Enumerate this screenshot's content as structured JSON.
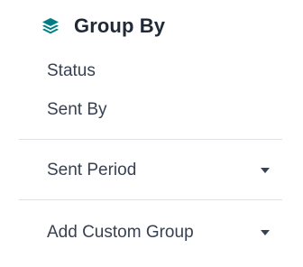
{
  "group_by": {
    "title": "Group By",
    "icon": "layers-icon",
    "accent_color": "#017e84",
    "options": [
      {
        "label": "Status"
      },
      {
        "label": "Sent By"
      }
    ],
    "sent_period": {
      "label": "Sent Period"
    },
    "custom_group": {
      "label": "Add Custom Group"
    }
  }
}
